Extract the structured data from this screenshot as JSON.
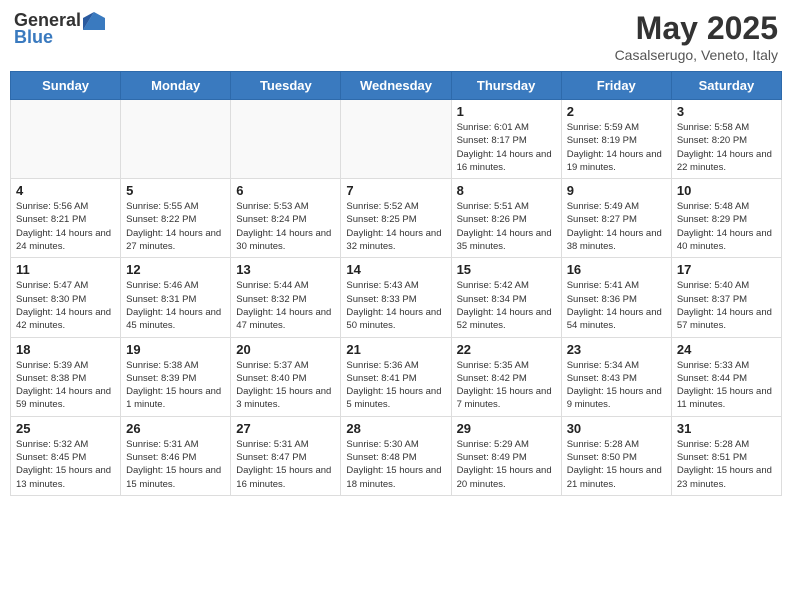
{
  "header": {
    "logo_general": "General",
    "logo_blue": "Blue",
    "title": "May 2025",
    "subtitle": "Casalserugo, Veneto, Italy"
  },
  "days_of_week": [
    "Sunday",
    "Monday",
    "Tuesday",
    "Wednesday",
    "Thursday",
    "Friday",
    "Saturday"
  ],
  "weeks": [
    [
      {
        "day": "",
        "empty": true
      },
      {
        "day": "",
        "empty": true
      },
      {
        "day": "",
        "empty": true
      },
      {
        "day": "",
        "empty": true
      },
      {
        "day": "1",
        "sunrise": "6:01 AM",
        "sunset": "8:17 PM",
        "daylight": "14 hours and 16 minutes."
      },
      {
        "day": "2",
        "sunrise": "5:59 AM",
        "sunset": "8:19 PM",
        "daylight": "14 hours and 19 minutes."
      },
      {
        "day": "3",
        "sunrise": "5:58 AM",
        "sunset": "8:20 PM",
        "daylight": "14 hours and 22 minutes."
      }
    ],
    [
      {
        "day": "4",
        "sunrise": "5:56 AM",
        "sunset": "8:21 PM",
        "daylight": "14 hours and 24 minutes."
      },
      {
        "day": "5",
        "sunrise": "5:55 AM",
        "sunset": "8:22 PM",
        "daylight": "14 hours and 27 minutes."
      },
      {
        "day": "6",
        "sunrise": "5:53 AM",
        "sunset": "8:24 PM",
        "daylight": "14 hours and 30 minutes."
      },
      {
        "day": "7",
        "sunrise": "5:52 AM",
        "sunset": "8:25 PM",
        "daylight": "14 hours and 32 minutes."
      },
      {
        "day": "8",
        "sunrise": "5:51 AM",
        "sunset": "8:26 PM",
        "daylight": "14 hours and 35 minutes."
      },
      {
        "day": "9",
        "sunrise": "5:49 AM",
        "sunset": "8:27 PM",
        "daylight": "14 hours and 38 minutes."
      },
      {
        "day": "10",
        "sunrise": "5:48 AM",
        "sunset": "8:29 PM",
        "daylight": "14 hours and 40 minutes."
      }
    ],
    [
      {
        "day": "11",
        "sunrise": "5:47 AM",
        "sunset": "8:30 PM",
        "daylight": "14 hours and 42 minutes."
      },
      {
        "day": "12",
        "sunrise": "5:46 AM",
        "sunset": "8:31 PM",
        "daylight": "14 hours and 45 minutes."
      },
      {
        "day": "13",
        "sunrise": "5:44 AM",
        "sunset": "8:32 PM",
        "daylight": "14 hours and 47 minutes."
      },
      {
        "day": "14",
        "sunrise": "5:43 AM",
        "sunset": "8:33 PM",
        "daylight": "14 hours and 50 minutes."
      },
      {
        "day": "15",
        "sunrise": "5:42 AM",
        "sunset": "8:34 PM",
        "daylight": "14 hours and 52 minutes."
      },
      {
        "day": "16",
        "sunrise": "5:41 AM",
        "sunset": "8:36 PM",
        "daylight": "14 hours and 54 minutes."
      },
      {
        "day": "17",
        "sunrise": "5:40 AM",
        "sunset": "8:37 PM",
        "daylight": "14 hours and 57 minutes."
      }
    ],
    [
      {
        "day": "18",
        "sunrise": "5:39 AM",
        "sunset": "8:38 PM",
        "daylight": "14 hours and 59 minutes."
      },
      {
        "day": "19",
        "sunrise": "5:38 AM",
        "sunset": "8:39 PM",
        "daylight": "15 hours and 1 minute."
      },
      {
        "day": "20",
        "sunrise": "5:37 AM",
        "sunset": "8:40 PM",
        "daylight": "15 hours and 3 minutes."
      },
      {
        "day": "21",
        "sunrise": "5:36 AM",
        "sunset": "8:41 PM",
        "daylight": "15 hours and 5 minutes."
      },
      {
        "day": "22",
        "sunrise": "5:35 AM",
        "sunset": "8:42 PM",
        "daylight": "15 hours and 7 minutes."
      },
      {
        "day": "23",
        "sunrise": "5:34 AM",
        "sunset": "8:43 PM",
        "daylight": "15 hours and 9 minutes."
      },
      {
        "day": "24",
        "sunrise": "5:33 AM",
        "sunset": "8:44 PM",
        "daylight": "15 hours and 11 minutes."
      }
    ],
    [
      {
        "day": "25",
        "sunrise": "5:32 AM",
        "sunset": "8:45 PM",
        "daylight": "15 hours and 13 minutes."
      },
      {
        "day": "26",
        "sunrise": "5:31 AM",
        "sunset": "8:46 PM",
        "daylight": "15 hours and 15 minutes."
      },
      {
        "day": "27",
        "sunrise": "5:31 AM",
        "sunset": "8:47 PM",
        "daylight": "15 hours and 16 minutes."
      },
      {
        "day": "28",
        "sunrise": "5:30 AM",
        "sunset": "8:48 PM",
        "daylight": "15 hours and 18 minutes."
      },
      {
        "day": "29",
        "sunrise": "5:29 AM",
        "sunset": "8:49 PM",
        "daylight": "15 hours and 20 minutes."
      },
      {
        "day": "30",
        "sunrise": "5:28 AM",
        "sunset": "8:50 PM",
        "daylight": "15 hours and 21 minutes."
      },
      {
        "day": "31",
        "sunrise": "5:28 AM",
        "sunset": "8:51 PM",
        "daylight": "15 hours and 23 minutes."
      }
    ]
  ],
  "labels": {
    "sunrise": "Sunrise:",
    "sunset": "Sunset:",
    "daylight": "Daylight:"
  }
}
